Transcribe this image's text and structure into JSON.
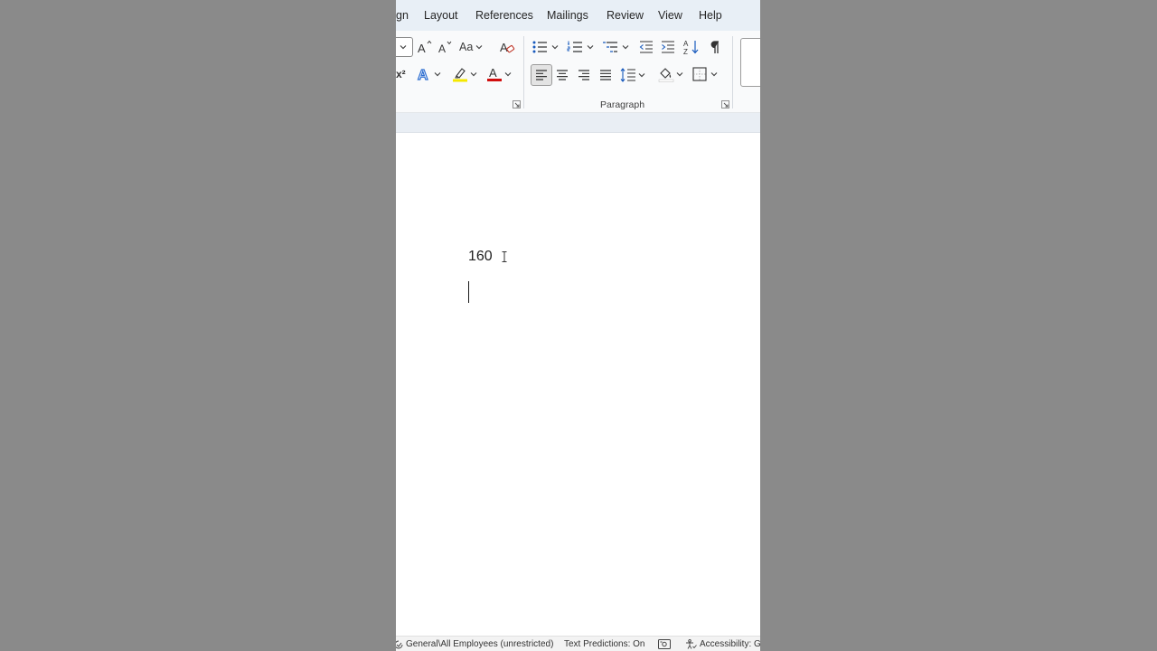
{
  "tabs": [
    "gn",
    "Layout",
    "References",
    "Mailings",
    "Review",
    "View",
    "Help"
  ],
  "ribbon": {
    "font": {
      "change_case_label": "Aa",
      "superscript_label": "x²"
    },
    "paragraph": {
      "group_label": "Paragraph"
    },
    "colors": {
      "highlight": "#f5e800",
      "font_color": "#d10e0e",
      "text_effects": "#2f6fd1",
      "accent": "#185abd"
    }
  },
  "document": {
    "text": "160"
  },
  "status_bar": {
    "sensitivity": "General\\All Employees (unrestricted)",
    "text_predictions": "Text Predictions: On",
    "accessibility": "Accessibility: Go"
  },
  "icons": {
    "grow_font": "font-grow-icon",
    "shrink_font": "font-shrink-icon",
    "clear_formatting": "clear-formatting-icon",
    "bullets": "bullets-icon",
    "numbering": "numbering-icon",
    "multilevel": "multilevel-list-icon",
    "decrease_indent": "decrease-indent-icon",
    "increase_indent": "increase-indent-icon",
    "sort": "sort-icon",
    "pilcrow": "pilcrow-icon",
    "shading": "shading-icon",
    "borders": "borders-icon"
  }
}
